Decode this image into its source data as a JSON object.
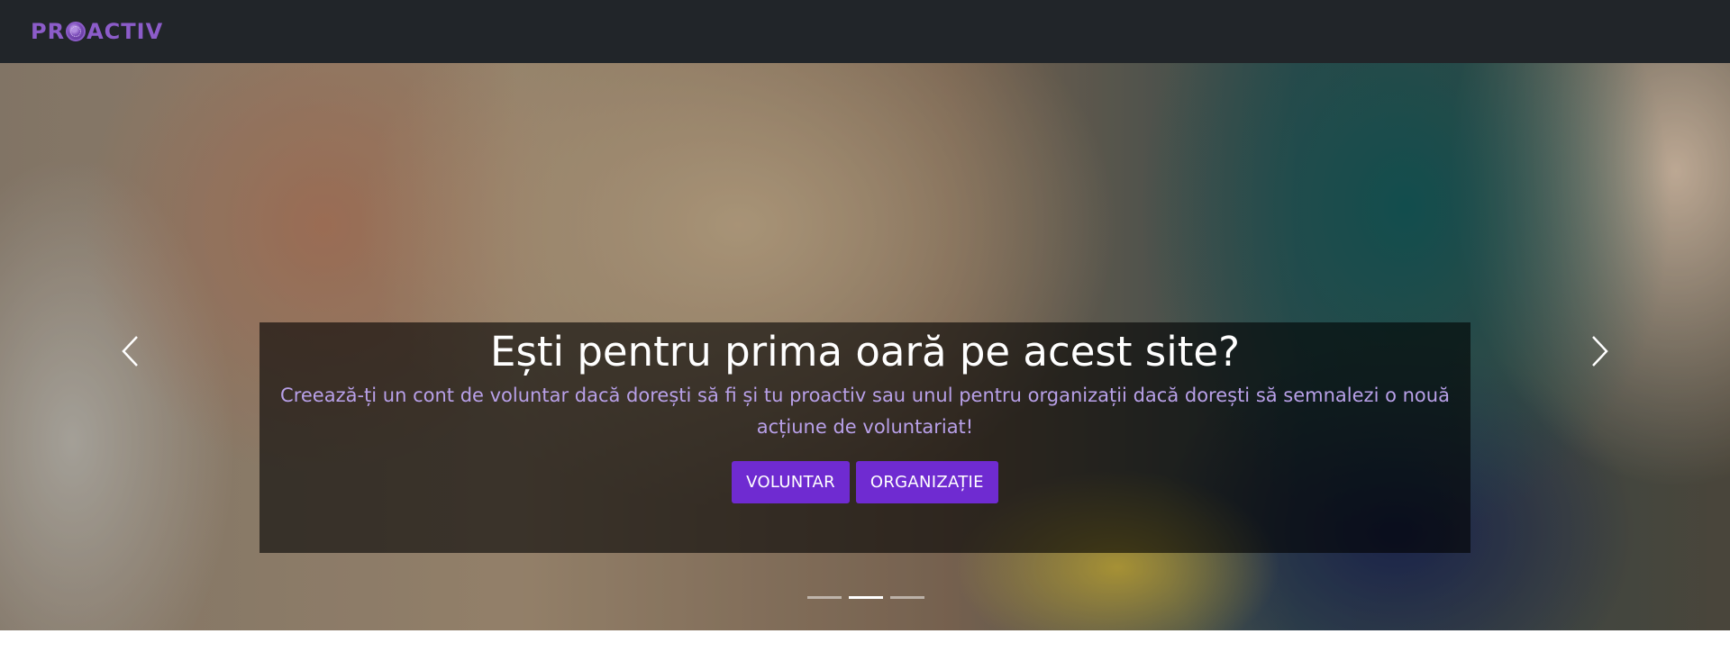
{
  "brand": {
    "logo_text_pre": "PR",
    "logo_text_post": "ACTIV",
    "accent_color": "#6f2bd1",
    "logo_color": "#8c5cc9"
  },
  "carousel": {
    "title": "Ești pentru prima oară pe acest site?",
    "subtitle": "Creează-ți un cont de voluntar dacă dorești să fi și tu proactiv sau unul pentru organizații dacă dorești să semnalezi o nouă acțiune de voluntariat!",
    "buttons": {
      "volunteer": "VOLUNTAR",
      "organization": "ORGANIZAȚIE"
    },
    "prev_icon": "chevron-left-icon",
    "next_icon": "chevron-right-icon",
    "slide_count": 3,
    "active_slide": 2
  }
}
